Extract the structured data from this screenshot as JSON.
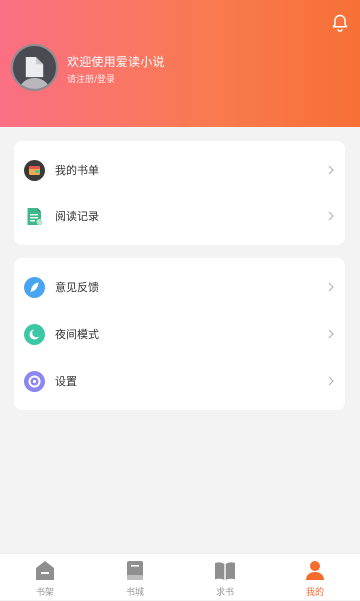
{
  "header": {
    "welcome_text": "欢迎使用爱读小说",
    "login_text": "请注册/登录",
    "bell_icon": "bell-icon",
    "avatar_icon": "avatar-icon"
  },
  "card_top": {
    "items": [
      {
        "label": "我的书单",
        "icon": "wallet-icon",
        "icon_color": "#3a3a3a"
      },
      {
        "label": "阅读记录",
        "icon": "document-icon",
        "icon_color": "#3fb98c"
      }
    ]
  },
  "card_bottom": {
    "items": [
      {
        "label": "意见反馈",
        "icon": "feather-icon",
        "icon_color": "#4aa5f0"
      },
      {
        "label": "夜间模式",
        "icon": "moon-icon",
        "icon_color": "#3cc8a6"
      },
      {
        "label": "设置",
        "icon": "settings-icon",
        "icon_color": "#8c86f3"
      }
    ]
  },
  "tabbar": {
    "tabs": [
      {
        "label": "书架",
        "icon": "bookshelf-icon",
        "active": false
      },
      {
        "label": "书城",
        "icon": "book-icon",
        "active": false
      },
      {
        "label": "求书",
        "icon": "open-book-icon",
        "active": false
      },
      {
        "label": "我的",
        "icon": "user-icon",
        "active": true
      }
    ],
    "active_color": "#f56a2d",
    "inactive_color": "#999999"
  },
  "colors": {
    "header_gradient_start": "#fb6f83",
    "header_gradient_end": "#f77036",
    "background": "#f3f3f3"
  }
}
